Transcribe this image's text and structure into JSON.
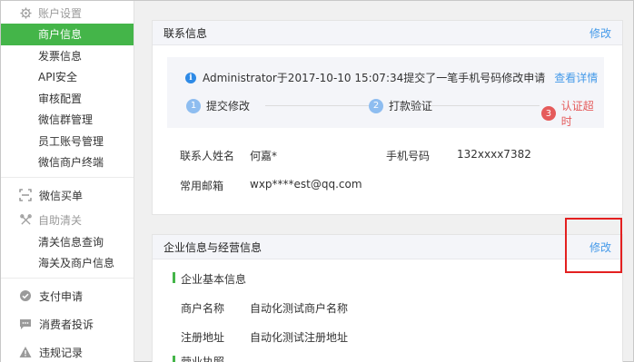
{
  "sidebar": {
    "account_group": "账户设置",
    "account_items": [
      {
        "label": "商户信息"
      },
      {
        "label": "发票信息"
      },
      {
        "label": "API安全"
      },
      {
        "label": "审核配置"
      },
      {
        "label": "微信群管理"
      },
      {
        "label": "员工账号管理"
      },
      {
        "label": "微信商户终端"
      }
    ],
    "wechat_bill": "微信买单",
    "customs_group": "自助清关",
    "customs_items": [
      {
        "label": "清关信息查询"
      },
      {
        "label": "海关及商户信息"
      }
    ],
    "payment_apply": "支付申请",
    "consumer_complaint": "消费者投诉",
    "violation_record": "违规记录"
  },
  "contact_card": {
    "title": "联系信息",
    "edit_label": "修改",
    "notice_text": "Administrator于2017-10-10 15:07:34提交了一笔手机号码修改申请",
    "notice_link": "查看详情",
    "steps": [
      {
        "num": "1",
        "label": "提交修改"
      },
      {
        "num": "2",
        "label": "打款验证"
      },
      {
        "num": "3",
        "label": "认证超时"
      }
    ],
    "name_label": "联系人姓名",
    "name_value": "何嘉*",
    "phone_label": "手机号码",
    "phone_value": "132xxxx7382",
    "email_label": "常用邮箱",
    "email_value": "wxp****est@qq.com"
  },
  "enterprise_card": {
    "title": "企业信息与经营信息",
    "edit_label": "修改",
    "basic_section": "企业基本信息",
    "merchant_name_label": "商户名称",
    "merchant_name_value": "自动化测试商户名称",
    "address_label": "注册地址",
    "address_value": "自动化测试注册地址",
    "license_section": "营业执照"
  },
  "colors": {
    "accent_green": "#44b549",
    "link_blue": "#459ae9",
    "timeout_red": "#e55b5b",
    "annotation_red": "#e32020"
  }
}
